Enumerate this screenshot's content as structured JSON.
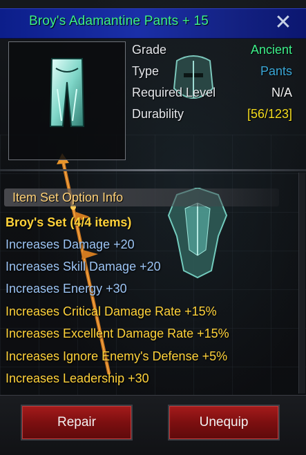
{
  "window": {
    "title": "Broy's Adamantine Pants + 15",
    "close_glyph": "✕"
  },
  "item_icon": "adamantine-pants-icon",
  "stats": [
    {
      "label": "Grade",
      "value": "Ancient",
      "color": "#3df08a"
    },
    {
      "label": "Type",
      "value": "Pants",
      "color": "#3aa6d6"
    },
    {
      "label": "Required Level",
      "value": "N/A",
      "color": "#f2f2f2"
    },
    {
      "label": "Durability",
      "value": "[56/123]",
      "color": "#f4dc1e"
    }
  ],
  "set_info": {
    "header": "Item Set Option Info",
    "set_name": "Broy's Set (4/4 items)",
    "options": [
      {
        "text": "Increases Damage +20",
        "color": "#9cc4f4"
      },
      {
        "text": "Increases Skill Damage +20",
        "color": "#9cc4f4"
      },
      {
        "text": "Increases Energy +30",
        "color": "#9cc4f4"
      },
      {
        "text": "Increases Critical Damage Rate +15%",
        "color": "#ffd23a"
      },
      {
        "text": "Increases Excellent Damage Rate +15%",
        "color": "#ffd23a"
      },
      {
        "text": "Increases Ignore Enemy's Defense +5%",
        "color": "#ffd23a"
      },
      {
        "text": "Increases Leadership +30",
        "color": "#ffd23a"
      }
    ]
  },
  "buttons": {
    "repair": "Repair",
    "unequip": "Unequip"
  }
}
